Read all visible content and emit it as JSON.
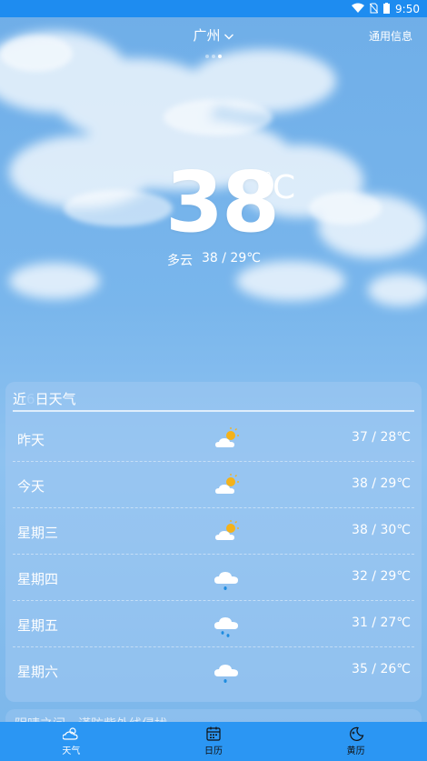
{
  "status_bar": {
    "time": "9:50"
  },
  "header": {
    "city": "广州",
    "general_info_label": "通用信息",
    "page_count": 3,
    "active_page": 2
  },
  "current": {
    "temperature": "38",
    "unit_circle": "°",
    "unit_c": "C",
    "condition": "多云",
    "range": "38 / 29℃"
  },
  "forecast": {
    "title_prefix": "近",
    "title_number": "6",
    "title_suffix": "日天气",
    "days": [
      {
        "day": "昨天",
        "icon": "partly-cloudy-icon",
        "range": "37 / 28℃"
      },
      {
        "day": "今天",
        "icon": "partly-cloudy-icon",
        "range": "38 / 29℃"
      },
      {
        "day": "星期三",
        "icon": "partly-cloudy-icon",
        "range": "38 / 30℃"
      },
      {
        "day": "星期四",
        "icon": "light-rain-icon",
        "range": "32 / 29℃"
      },
      {
        "day": "星期五",
        "icon": "rain-icon",
        "range": "31 / 27℃"
      },
      {
        "day": "星期六",
        "icon": "light-rain-icon",
        "range": "35 / 26℃"
      }
    ]
  },
  "peek_text": "阴晴之间，谨防紫外线侵扰",
  "bottom_nav": [
    {
      "label": "天气",
      "icon": "weather-icon",
      "active": true
    },
    {
      "label": "日历",
      "icon": "calendar-icon",
      "active": false
    },
    {
      "label": "黄历",
      "icon": "moon-icon",
      "active": false
    }
  ],
  "colors": {
    "status_bar": "#1e8cf0",
    "nav_bar": "#2b96f3",
    "sky": "#79b6ec",
    "sun": "#f4b21a",
    "rain": "#1e8ce0"
  }
}
